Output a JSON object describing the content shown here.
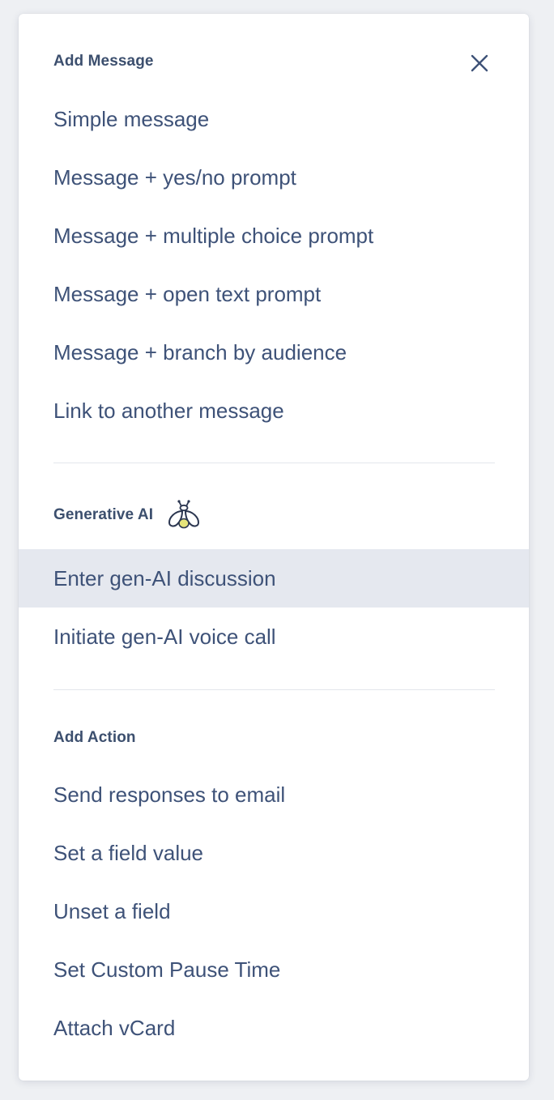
{
  "sections": {
    "add_message": {
      "title": "Add Message",
      "items": [
        "Simple message",
        "Message + yes/no prompt",
        "Message + multiple choice prompt",
        "Message + open text prompt",
        "Message + branch by audience",
        "Link to another message"
      ]
    },
    "generative_ai": {
      "title": "Generative AI",
      "icon": "firefly-bee-icon",
      "items": [
        "Enter gen-AI discussion",
        "Initiate gen-AI voice call"
      ],
      "highlighted_index": 0
    },
    "add_action": {
      "title": "Add Action",
      "items": [
        "Send responses to email",
        "Set a field value",
        "Unset a field",
        "Set Custom Pause Time",
        "Attach vCard"
      ]
    }
  },
  "close_icon": "close-icon",
  "colors": {
    "text": "#3e5278",
    "header": "#3c4f6e",
    "highlight": "#e5e8ef",
    "accent_yellow": "#e6e47a",
    "divider": "#e3e6ec"
  }
}
